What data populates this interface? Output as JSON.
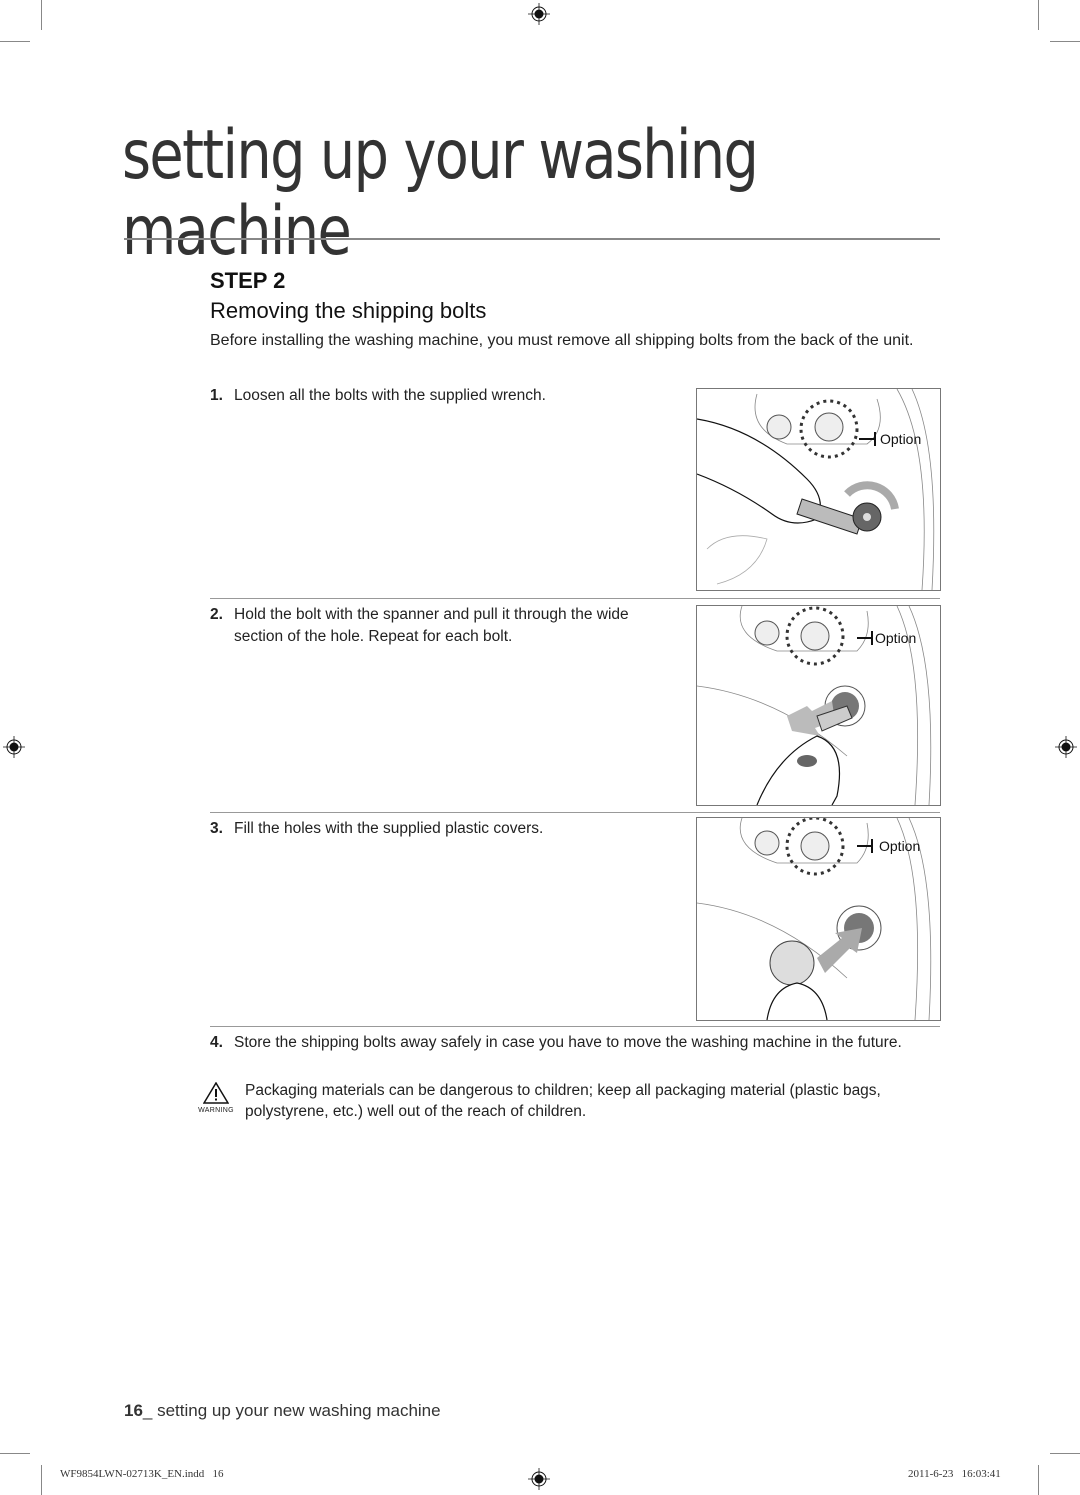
{
  "page": {
    "title_line1": "setting up your washing",
    "title_line2": "machine",
    "step_label": "STEP 2",
    "section_title": "Removing the shipping bolts",
    "intro": "Before installing the washing machine, you must remove all shipping bolts from the back of the unit.",
    "steps": [
      {
        "number": "1.",
        "text": "Loosen all the bolts with the supplied wrench."
      },
      {
        "number": "2.",
        "text": "Hold the bolt with the spanner and pull it through the wide section of the hole. Repeat for each bolt."
      },
      {
        "number": "3.",
        "text": "Fill the holes with the supplied plastic covers."
      },
      {
        "number": "4.",
        "text": "Store the shipping bolts away safely in case you have to move the washing machine in the future."
      }
    ],
    "figures": [
      {
        "option_label": "Option",
        "depicts": "hand loosening bolt with wrench"
      },
      {
        "option_label": "Option",
        "depicts": "hand pulling bolt out with arrow"
      },
      {
        "option_label": "Option",
        "depicts": "hand inserting plastic cover with arrow"
      }
    ],
    "warning": {
      "icon_label": "WARNING",
      "text": "Packaging materials can be dangerous to children; keep all packaging material (plastic bags, polystyrene, etc.) well out of the reach of children."
    },
    "footer": {
      "page_number": "16",
      "page_text": "_ setting up your new washing machine"
    },
    "print_slug": {
      "file": "WF9854LWN-02713K_EN.indd   16",
      "date": "2011-6-23   16:03:41"
    }
  }
}
